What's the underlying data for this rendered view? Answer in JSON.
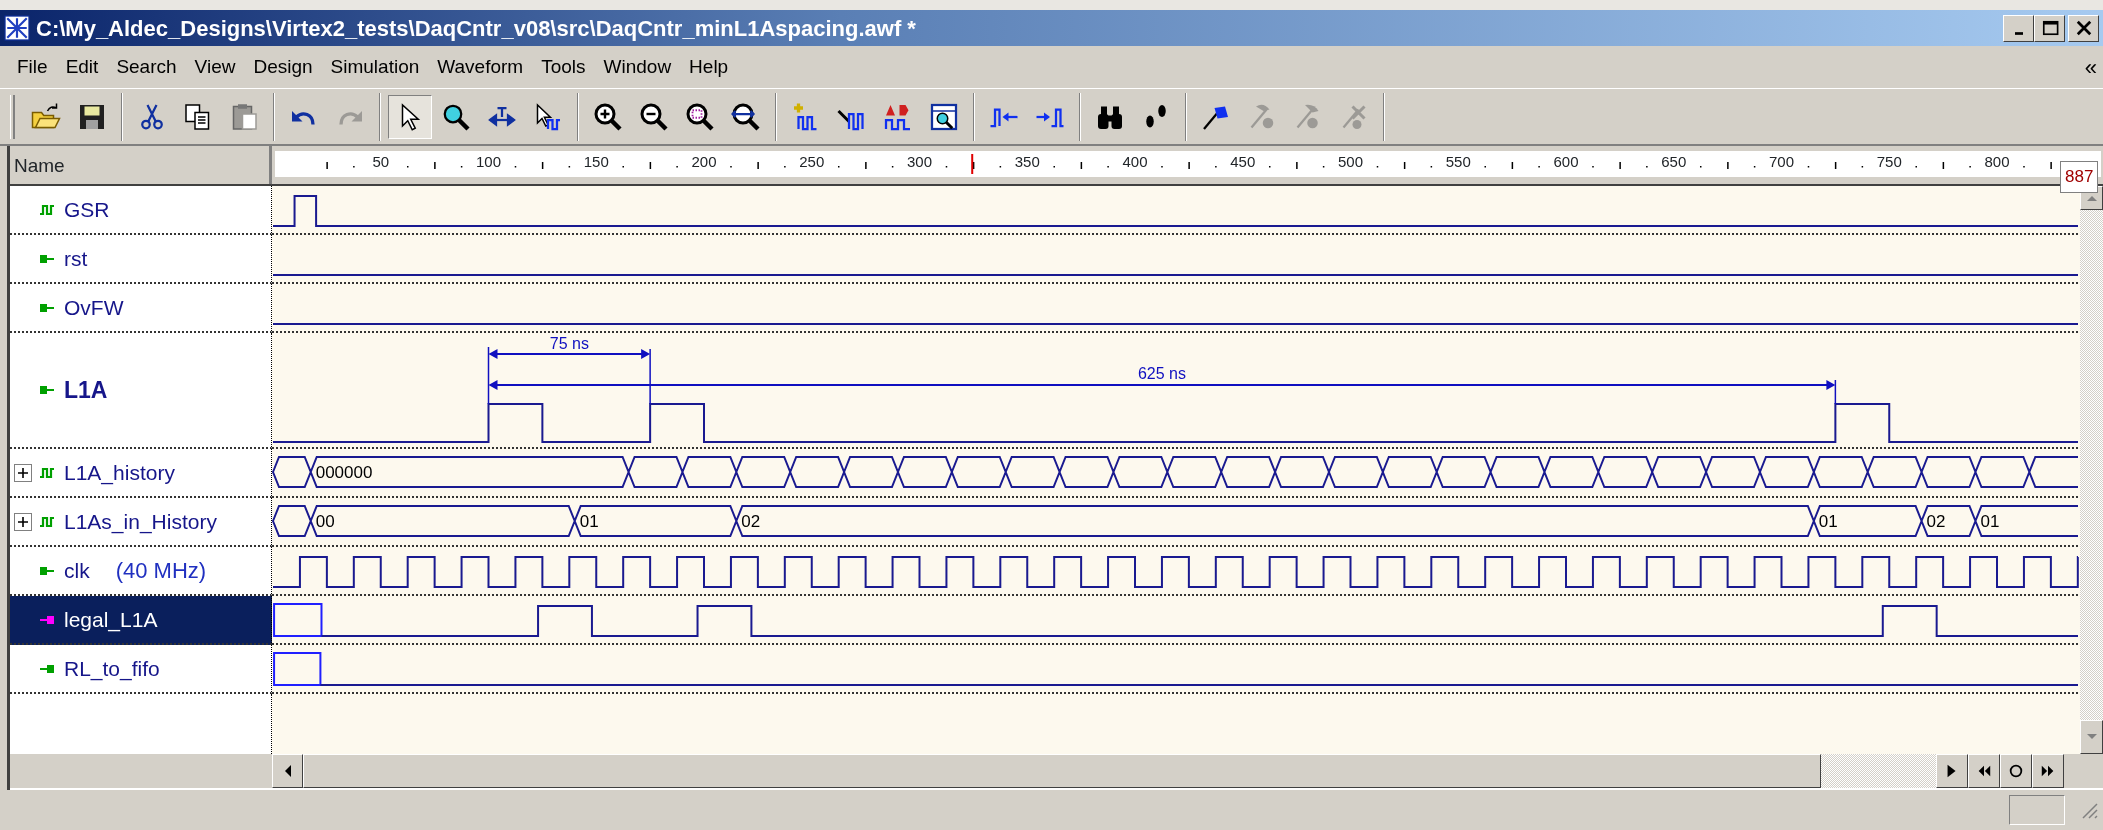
{
  "window": {
    "title": "C:\\My_Aldec_Designs\\Virtex2_tests\\DaqCntr_v08\\src\\DaqCntr_minL1Aspacing.awf *"
  },
  "menu": [
    {
      "label": "File"
    },
    {
      "label": "Edit"
    },
    {
      "label": "Search"
    },
    {
      "label": "View"
    },
    {
      "label": "Design"
    },
    {
      "label": "Simulation"
    },
    {
      "label": "Waveform"
    },
    {
      "label": "Tools"
    },
    {
      "label": "Window"
    },
    {
      "label": "Help"
    }
  ],
  "menu_chevron": "«",
  "toolbar": [
    [
      {
        "kind": "open",
        "disabled": false,
        "pressed": false
      },
      {
        "kind": "save",
        "disabled": false,
        "pressed": false
      }
    ],
    [
      {
        "kind": "cut",
        "disabled": false,
        "pressed": false
      },
      {
        "kind": "copy",
        "disabled": false,
        "pressed": false
      },
      {
        "kind": "paste",
        "disabled": true,
        "pressed": false
      }
    ],
    [
      {
        "kind": "undo",
        "disabled": false,
        "pressed": false
      },
      {
        "kind": "redo",
        "disabled": true,
        "pressed": false
      }
    ],
    [
      {
        "kind": "pointer",
        "disabled": false,
        "pressed": true
      },
      {
        "kind": "zoom",
        "disabled": false,
        "pressed": false
      },
      {
        "kind": "measure",
        "disabled": false,
        "pressed": false
      },
      {
        "kind": "select_wave",
        "disabled": false,
        "pressed": false
      }
    ],
    [
      {
        "kind": "zoom_in",
        "disabled": false,
        "pressed": false
      },
      {
        "kind": "zoom_out",
        "disabled": false,
        "pressed": false
      },
      {
        "kind": "zoom_fit",
        "disabled": false,
        "pressed": false
      },
      {
        "kind": "zoom_range",
        "disabled": false,
        "pressed": false
      }
    ],
    [
      {
        "kind": "add_signal",
        "disabled": false,
        "pressed": false
      },
      {
        "kind": "edit_wave",
        "disabled": false,
        "pressed": false
      },
      {
        "kind": "label_wave",
        "disabled": false,
        "pressed": false
      },
      {
        "kind": "browse",
        "disabled": false,
        "pressed": false
      }
    ],
    [
      {
        "kind": "prev_edge",
        "disabled": false,
        "pressed": false
      },
      {
        "kind": "next_edge",
        "disabled": false,
        "pressed": false
      }
    ],
    [
      {
        "kind": "find",
        "disabled": false,
        "pressed": false
      },
      {
        "kind": "step",
        "disabled": false,
        "pressed": false
      }
    ],
    [
      {
        "kind": "flag",
        "disabled": false,
        "pressed": false
      },
      {
        "kind": "marker_prev",
        "disabled": true,
        "pressed": false
      },
      {
        "kind": "marker_next",
        "disabled": true,
        "pressed": false
      },
      {
        "kind": "marker_delete",
        "disabled": true,
        "pressed": false
      }
    ]
  ],
  "waveform": {
    "name_header": "Name",
    "ruler_labels": [
      "50",
      "100",
      "150",
      "200",
      "250",
      "300",
      "350",
      "400",
      "450",
      "500",
      "550",
      "600",
      "650",
      "700",
      "750",
      "800"
    ],
    "time_tooltip": "887",
    "signals": [
      {
        "name": "GSR",
        "kind": "stimulator",
        "color": "#00a000",
        "selected": false,
        "emphasized": false
      },
      {
        "name": "rst",
        "kind": "input",
        "color": "#00a000",
        "selected": false,
        "emphasized": false
      },
      {
        "name": "OvFW",
        "kind": "input",
        "color": "#00a000",
        "selected": false,
        "emphasized": false
      },
      {
        "name": "L1A",
        "kind": "input",
        "color": "#00a000",
        "selected": false,
        "emphasized": true,
        "measurements": [
          {
            "label": "75 ns"
          },
          {
            "label": "625 ns"
          }
        ]
      },
      {
        "name": "L1A_history",
        "kind": "stimulator",
        "color": "#00a000",
        "selected": false,
        "emphasized": false,
        "expanded": false,
        "values": [
          "000000"
        ]
      },
      {
        "name": "L1As_in_History",
        "kind": "stimulator",
        "color": "#00a000",
        "selected": false,
        "emphasized": false,
        "expanded": false,
        "values": [
          "00",
          "01",
          "02",
          "01",
          "02",
          "01"
        ]
      },
      {
        "name": "clk",
        "note": "(40 MHz)",
        "kind": "input",
        "color": "#00a000",
        "selected": false,
        "emphasized": false
      },
      {
        "name": "legal_L1A",
        "kind": "output",
        "color": "#ff00ff",
        "selected": true,
        "emphasized": false
      },
      {
        "name": "RL_to_fifo",
        "kind": "output",
        "color": "#00a000",
        "selected": false,
        "emphasized": false
      }
    ]
  }
}
